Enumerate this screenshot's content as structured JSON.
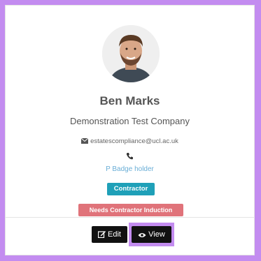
{
  "profile": {
    "name": "Ben Marks",
    "company": "Demonstration Test Company",
    "email": "estatescompliance@ucl.ac.uk",
    "badge_status": "P Badge holder"
  },
  "labels": {
    "contractor": "Contractor",
    "induction": "Needs Contractor Induction"
  },
  "actions": {
    "edit_label": "Edit",
    "view_label": "View"
  },
  "icons": {
    "email": "envelope-icon",
    "phone": "phone-icon",
    "edit": "edit-icon",
    "view": "eye-icon"
  },
  "colors": {
    "highlight": "#c38cf0",
    "contractor_badge": "#1fa0b8",
    "induction_badge": "#e0737a",
    "link": "#6aaed6"
  }
}
